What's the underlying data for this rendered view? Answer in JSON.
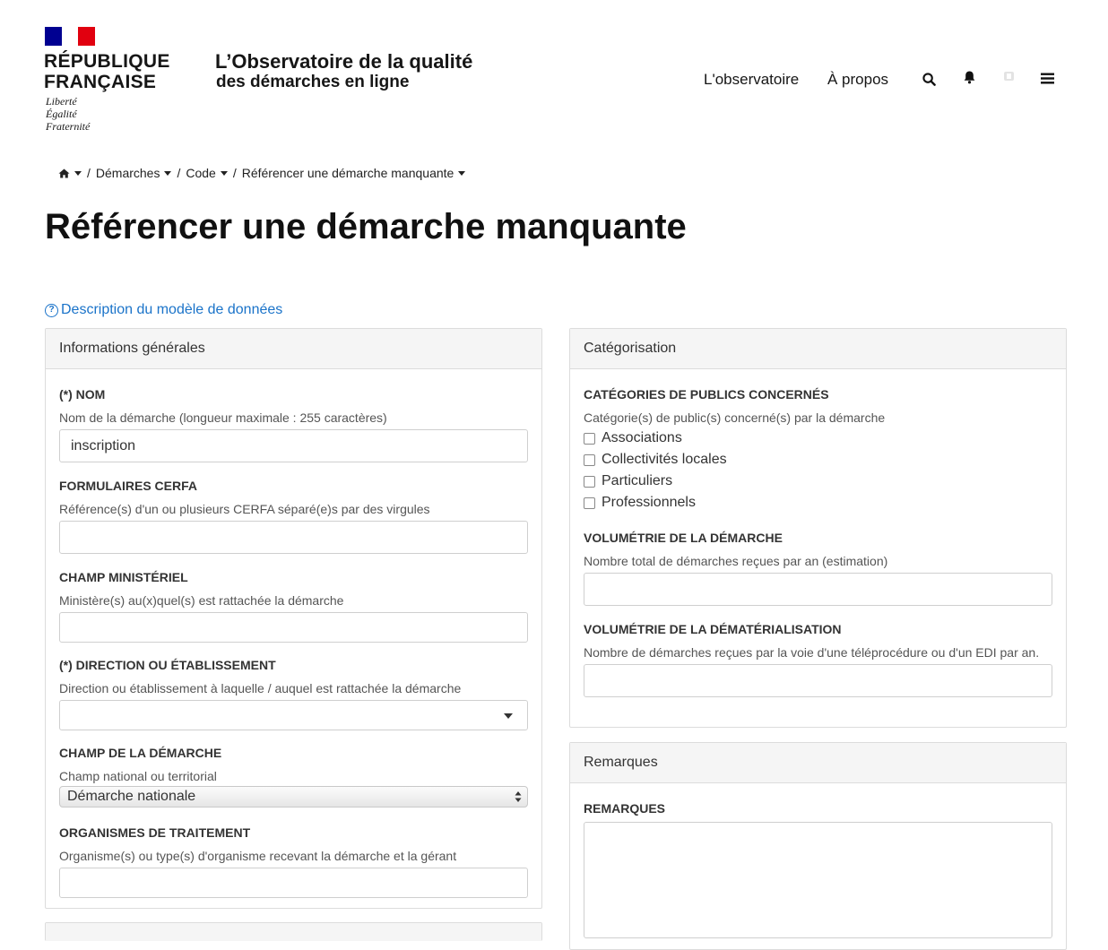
{
  "header": {
    "rf_name_line1": "RÉPUBLIQUE",
    "rf_name_line2": "FRANÇAISE",
    "motto": [
      "Liberté",
      "Égalité",
      "Fraternité"
    ],
    "site_title": "L’Observatoire de la qualité",
    "site_subtitle": "des démarches en ligne",
    "nav": {
      "observatoire": "L'observatoire",
      "apropos": "À propos"
    },
    "icons": [
      "search-icon",
      "bell-icon",
      "user-icon",
      "menu-icon"
    ]
  },
  "breadcrumb": {
    "home_icon": "home-icon",
    "items": [
      "Démarches",
      "Code",
      "Référencer une démarche manquante"
    ],
    "separator": "/"
  },
  "page_title": "Référencer une démarche manquante",
  "model_link": {
    "icon": "?",
    "label": "Description du modèle de données"
  },
  "general_panel": {
    "heading": "Informations générales",
    "nom": {
      "label": "(*) NOM",
      "help": "Nom de la démarche (longueur maximale : 255 caractères)",
      "value": "inscription"
    },
    "cerfa": {
      "label": "FORMULAIRES CERFA",
      "help": "Référence(s) d'un ou plusieurs CERFA séparé(e)s par des virgules",
      "value": ""
    },
    "ministeriel": {
      "label": "CHAMP MINISTÉRIEL",
      "help": "Ministère(s) au(x)quel(s) est rattachée la démarche",
      "value": ""
    },
    "direction": {
      "label": "(*) DIRECTION OU ÉTABLISSEMENT",
      "help": "Direction ou établissement à laquelle / auquel est rattachée la démarche",
      "value": ""
    },
    "champ": {
      "label": "CHAMP DE LA DÉMARCHE",
      "help": "Champ national ou territorial",
      "selected": "Démarche nationale"
    },
    "organismes": {
      "label": "ORGANISMES DE TRAITEMENT",
      "help": "Organisme(s) ou type(s) d'organisme recevant la démarche et la gérant",
      "value": ""
    }
  },
  "categorisation_panel": {
    "heading": "Catégorisation",
    "publics": {
      "label": "CATÉGORIES DE PUBLICS CONCERNÉS",
      "help": "Catégorie(s) de public(s) concerné(s) par la démarche",
      "options": [
        "Associations",
        "Collectivités locales",
        "Particuliers",
        "Professionnels"
      ]
    },
    "volumetrie": {
      "label": "VOLUMÉTRIE DE LA DÉMARCHE",
      "help": "Nombre total de démarches reçues par an (estimation)",
      "value": ""
    },
    "dematerialisation": {
      "label": "VOLUMÉTRIE DE LA DÉMATÉRIALISATION",
      "help": "Nombre de démarches reçues par la voie d'une téléprocédure ou d'un EDI par an.",
      "value": ""
    }
  },
  "remarques_panel": {
    "heading": "Remarques",
    "label": "REMARQUES",
    "value": ""
  },
  "colors": {
    "link": "#1a73c9",
    "flag_blue": "#000091",
    "flag_red": "#e1000f",
    "panel_heading_bg": "#f5f5f5",
    "border": "#dcdcdc"
  }
}
